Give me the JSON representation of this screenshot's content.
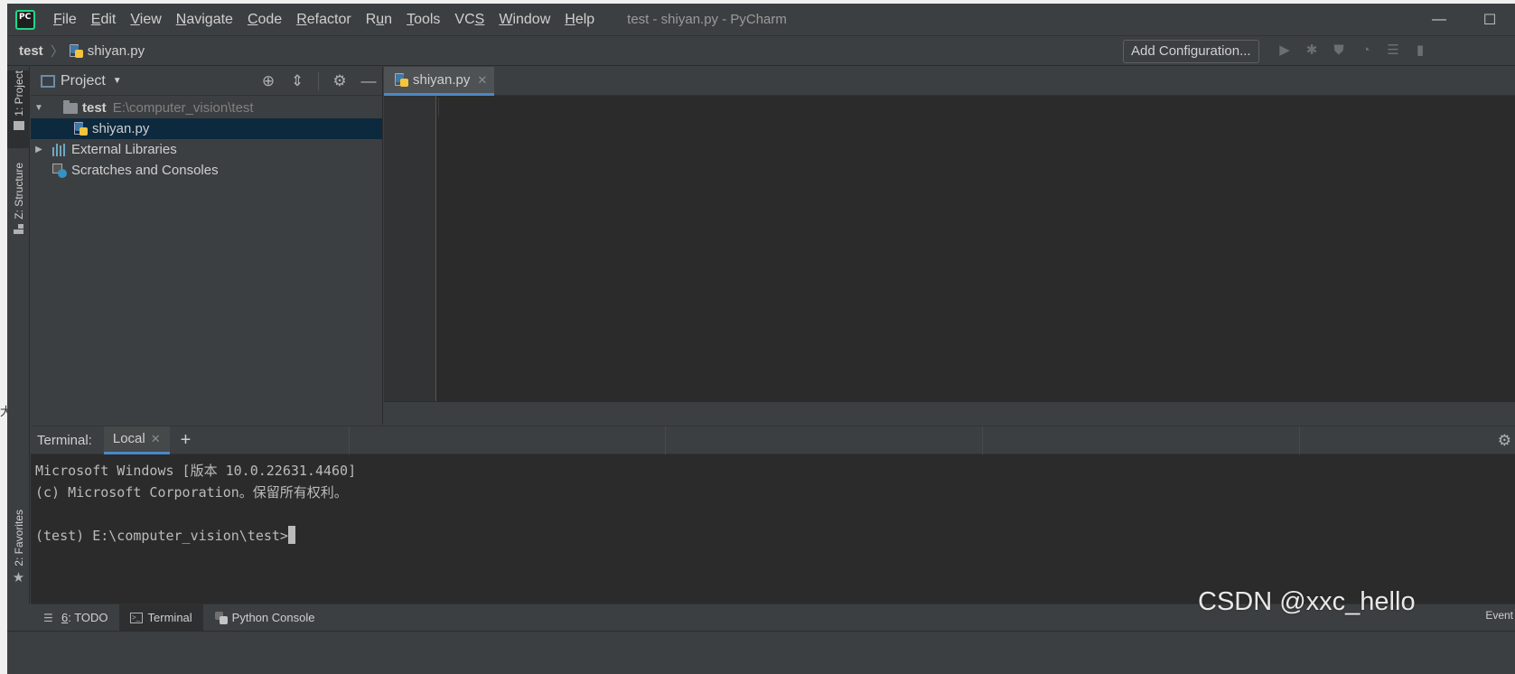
{
  "window": {
    "title": "test - shiyan.py - PyCharm",
    "logo_text": "PC",
    "menu": [
      {
        "label": "File",
        "mnemonic": "F",
        "rest": "ile"
      },
      {
        "label": "Edit",
        "mnemonic": "E",
        "rest": "dit"
      },
      {
        "label": "View",
        "mnemonic": "V",
        "rest": "iew"
      },
      {
        "label": "Navigate",
        "mnemonic": "N",
        "rest": "avigate"
      },
      {
        "label": "Code",
        "mnemonic": "C",
        "rest": "ode"
      },
      {
        "label": "Refactor",
        "mnemonic": "R",
        "rest": "efactor"
      },
      {
        "label": "Run",
        "mnemonic": "u",
        "pre": "R",
        "rest": "n"
      },
      {
        "label": "Tools",
        "mnemonic": "T",
        "rest": "ools"
      },
      {
        "label": "VCS",
        "mnemonic": "S",
        "pre": "VC",
        "rest": ""
      },
      {
        "label": "Window",
        "mnemonic": "W",
        "rest": "indow"
      },
      {
        "label": "Help",
        "mnemonic": "H",
        "rest": "elp"
      }
    ],
    "minimize_glyph": "—",
    "maximize_glyph": "☐"
  },
  "navbar": {
    "root": "test",
    "separator": "〉",
    "file": "shiyan.py",
    "add_configuration": "Add Configuration...",
    "run_glyphs": [
      "▶",
      "✱",
      "⛊",
      "◔",
      "☰",
      "▮"
    ]
  },
  "left_stripe": {
    "project": "1: Project",
    "structure": "Z: Structure",
    "favorites": "2: Favorites"
  },
  "project_panel": {
    "title": "Project",
    "caret": "▼",
    "tool_glyphs": {
      "locate": "⊕",
      "collapse": "⇕",
      "settings": "⚙",
      "hide": "—"
    },
    "tree": {
      "root_name": "test",
      "root_path": "E:\\computer_vision\\test",
      "file": "shiyan.py",
      "libraries": "External Libraries",
      "scratches": "Scratches and Consoles"
    },
    "expanded_glyph": "▼",
    "collapsed_glyph": "▶"
  },
  "editor": {
    "tab_label": "shiyan.py",
    "close_glyph": "✕"
  },
  "terminal": {
    "label": "Terminal:",
    "tab": "Local",
    "add_glyph": "+",
    "gear_glyph": "⚙",
    "lines": [
      "Microsoft Windows [版本 10.0.22631.4460]",
      "(c) Microsoft Corporation。保留所有权利。",
      "",
      "(test) E:\\computer_vision\\test>"
    ]
  },
  "bottom_bar": {
    "todo_number": "6",
    "todo_label": ": TODO",
    "terminal": "Terminal",
    "python_console": "Python Console",
    "event": "Event"
  },
  "watermark": "CSDN @xxc_hello",
  "outside_glyph": "大",
  "colors": {
    "accent": "#4a88c7",
    "selection": "#0d293e",
    "background": "#3c3f41",
    "editor": "#2b2b2b"
  }
}
